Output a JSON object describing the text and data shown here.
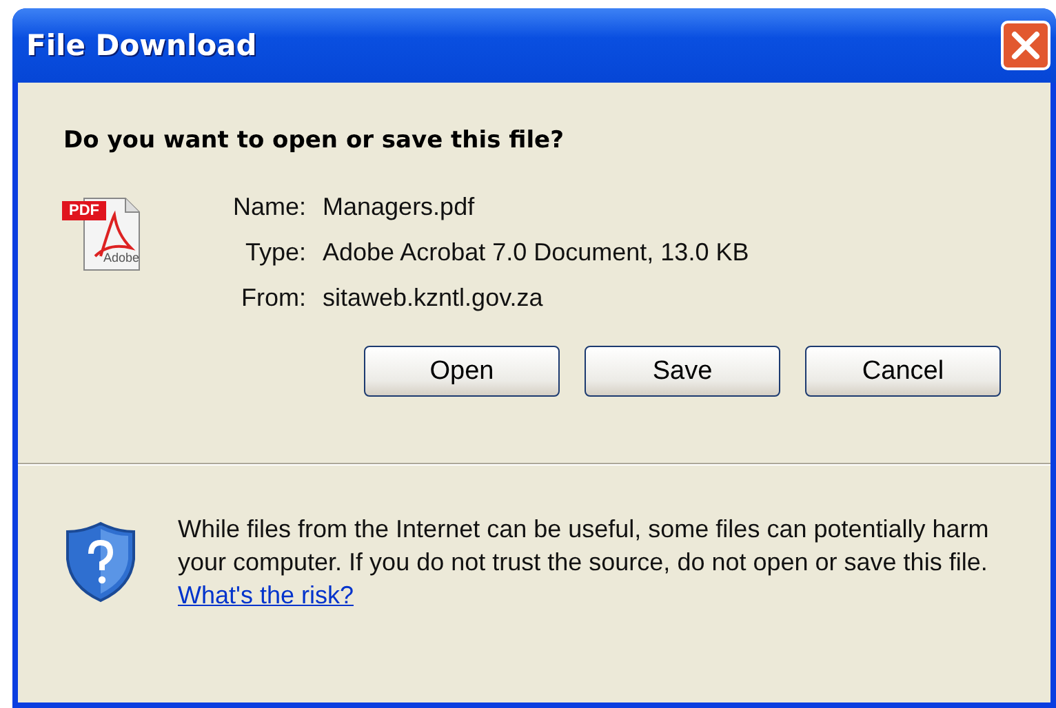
{
  "window": {
    "title": "File Download"
  },
  "heading": "Do you want to open or save this file?",
  "file_icon": {
    "badge": "PDF",
    "caption": "Adobe"
  },
  "fields": [
    {
      "label": "Name:",
      "value": "Managers.pdf"
    },
    {
      "label": "Type:",
      "value": "Adobe Acrobat 7.0 Document, 13.0 KB"
    },
    {
      "label": "From:",
      "value": "sitaweb.kzntl.gov.za"
    }
  ],
  "buttons": [
    "Open",
    "Save",
    "Cancel"
  ],
  "warning": {
    "text": "While files from the Internet can be useful, some files can potentially harm your computer. If you do not trust the source, do not open or save this file.",
    "link": "What's the risk?"
  }
}
